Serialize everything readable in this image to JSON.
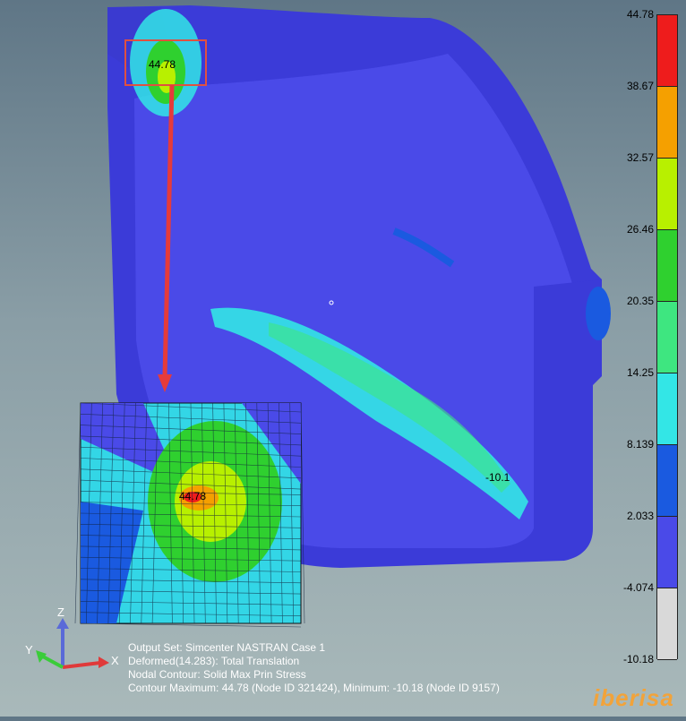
{
  "legend": {
    "values": [
      "44.78",
      "38.67",
      "32.57",
      "26.46",
      "20.35",
      "14.25",
      "8.139",
      "2.033",
      "-4.074",
      "-10.18"
    ],
    "colors": [
      "#ee1c1c",
      "#f5a000",
      "#b8f000",
      "#2fd02f",
      "#3ee680",
      "#33e6e6",
      "#1a5ae0",
      "#4a4ae8",
      "#d9d9d9"
    ]
  },
  "labels": {
    "max_top": "44.78",
    "max_zoom": "44.78",
    "min_marker": "-10.1"
  },
  "triad": {
    "z": "Z",
    "y": "Y",
    "x": "X"
  },
  "info": {
    "line1": "Output Set: Simcenter NASTRAN Case 1",
    "line2": "Deformed(14.283): Total Translation",
    "line3": "Nodal Contour: Solid Max Prin Stress",
    "line4": "Contour Maximum: 44.78 (Node ID 321424), Minimum: -10.18 (Node ID 9157)"
  },
  "brand": "iberisa",
  "colors": {
    "highlight_box": "#e05040",
    "arrow": "#e53b3b",
    "part_base": "#4a4ae8"
  }
}
